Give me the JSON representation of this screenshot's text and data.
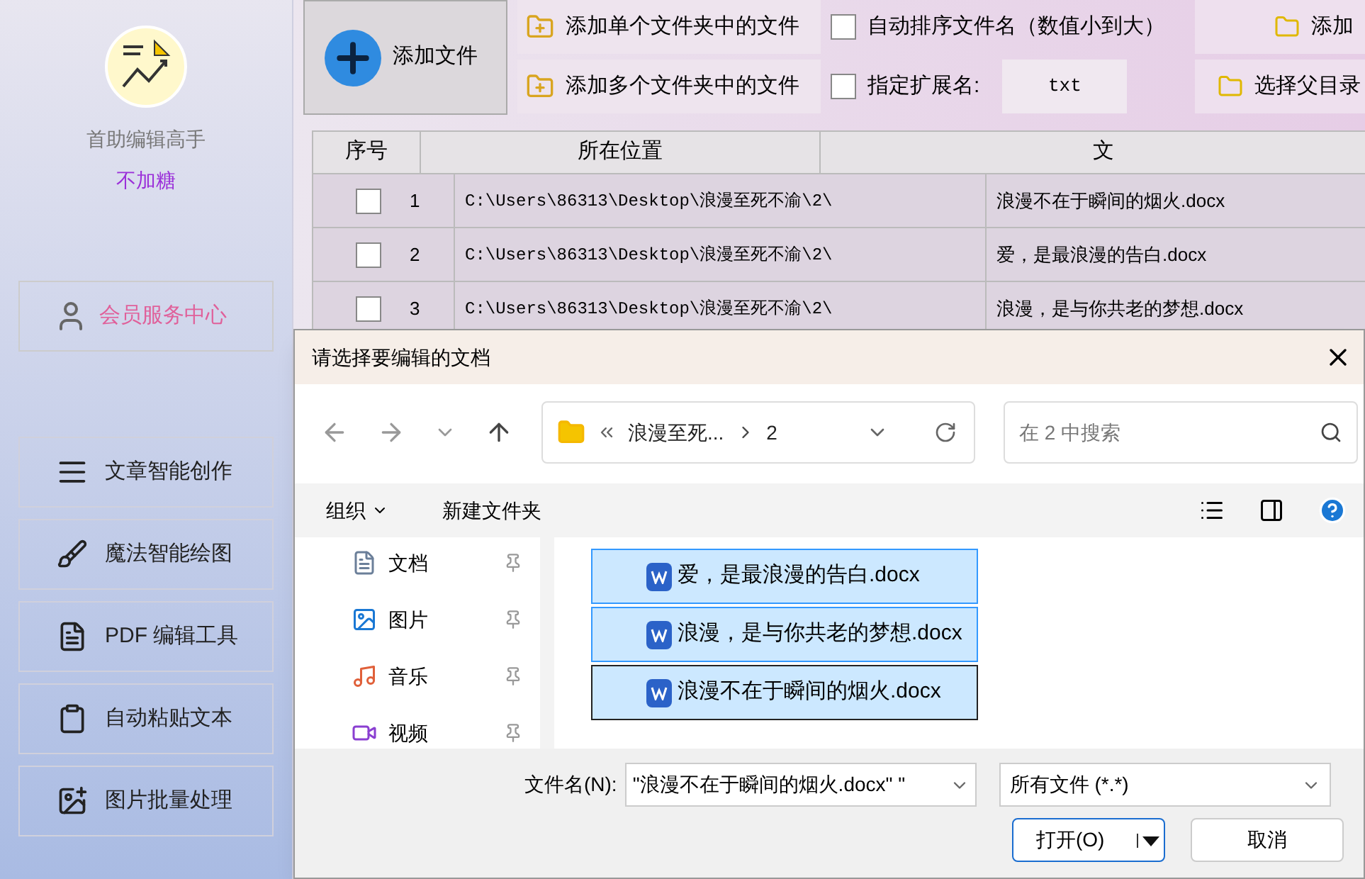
{
  "app": {
    "name": "首助编辑高手",
    "user": "不加糖"
  },
  "sidebar": {
    "member": "会员服务中心",
    "items": [
      {
        "label": "文章智能创作",
        "kind": "lines"
      },
      {
        "label": "魔法智能绘图",
        "kind": "brush"
      },
      {
        "label": "PDF 编辑工具",
        "kind": "pdf"
      },
      {
        "label": "自动粘贴文本",
        "kind": "paste"
      },
      {
        "label": "图片批量处理",
        "kind": "image"
      }
    ]
  },
  "toolbar": {
    "add_file": "添加文件",
    "add_single": "添加单个文件夹中的文件",
    "add_multi": "添加多个文件夹中的文件",
    "auto_sort": {
      "label": "自动排序文件名（数值小到大）",
      "checked": false
    },
    "ext": {
      "label": "指定扩展名:",
      "checked": false,
      "value": "txt"
    },
    "button_3": "添加",
    "button_4": "选择父目录"
  },
  "table": {
    "columns": [
      "序号",
      "所在位置",
      "文"
    ],
    "rows": [
      {
        "checked": false,
        "index": "1",
        "location": "C:\\Users\\86313\\Desktop\\浪漫至死不渝\\2\\",
        "name": "浪漫不在于瞬间的烟火.docx"
      },
      {
        "checked": false,
        "index": "2",
        "location": "C:\\Users\\86313\\Desktop\\浪漫至死不渝\\2\\",
        "name": "爱，是最浪漫的告白.docx"
      },
      {
        "checked": false,
        "index": "3",
        "location": "C:\\Users\\86313\\Desktop\\浪漫至死不渝\\2\\",
        "name": "浪漫，是与你共老的梦想.docx"
      }
    ]
  },
  "dialog": {
    "title": "请选择要编辑的文档",
    "path": [
      "浪漫至死...",
      "2"
    ],
    "search_placeholder": "在 2 中搜索",
    "organize": "组织",
    "new_folder": "新建文件夹",
    "nav": [
      {
        "label": "文档",
        "kind": "docs"
      },
      {
        "label": "图片",
        "kind": "pictures"
      },
      {
        "label": "音乐",
        "kind": "music"
      },
      {
        "label": "视频",
        "kind": "video"
      }
    ],
    "files": [
      {
        "name": "爱，是最浪漫的告白.docx",
        "selected": true,
        "focused": false
      },
      {
        "name": "浪漫，是与你共老的梦想.docx",
        "selected": true,
        "focused": false
      },
      {
        "name": "浪漫不在于瞬间的烟火.docx",
        "selected": true,
        "focused": true
      }
    ],
    "filename_label": "文件名(N):",
    "filename_value": "\"浪漫不在于瞬间的烟火.docx\" \"",
    "filter": "所有文件 (*.*)",
    "open": "打开(O)",
    "cancel": "取消"
  }
}
